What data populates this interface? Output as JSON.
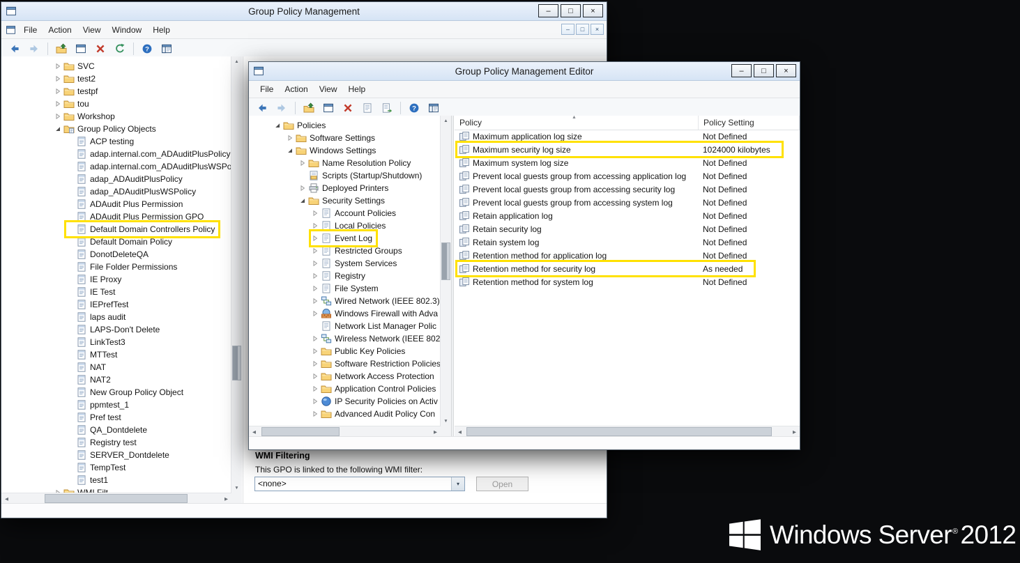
{
  "desktop_bg": "#0A0B0D",
  "highlight_color": "#FFE100",
  "branding": {
    "name": "Windows Server",
    "reg": "®",
    "year": "2012"
  },
  "gpm": {
    "title": "Group Policy Management",
    "menu": [
      "File",
      "Action",
      "View",
      "Window",
      "Help"
    ],
    "title_buttons": [
      "minimize",
      "maximize",
      "close"
    ],
    "mini_buttons": [
      "minimize",
      "restore",
      "close"
    ],
    "toolbar": [
      "back",
      "forward",
      "sep",
      "up-one-level",
      "console-window",
      "delete",
      "refresh",
      "sep",
      "help",
      "console-tree"
    ],
    "tree": [
      {
        "label": "SVC",
        "indent": 1,
        "arrow": "collapsed",
        "icon": "ou-folder"
      },
      {
        "label": "test2",
        "indent": 1,
        "arrow": "collapsed",
        "icon": "ou-folder"
      },
      {
        "label": "testpf",
        "indent": 1,
        "arrow": "collapsed",
        "icon": "ou-folder"
      },
      {
        "label": "tou",
        "indent": 1,
        "arrow": "collapsed",
        "icon": "ou-folder"
      },
      {
        "label": "Workshop",
        "indent": 1,
        "arrow": "collapsed",
        "icon": "folder"
      },
      {
        "label": "Group Policy Objects",
        "indent": 1,
        "arrow": "expanded",
        "icon": "gpo-folder"
      },
      {
        "label": "ACP testing",
        "indent": 2,
        "arrow": "none",
        "icon": "gpo"
      },
      {
        "label": "adap.internal.com_ADAuditPlusPolicy",
        "indent": 2,
        "arrow": "none",
        "icon": "gpo"
      },
      {
        "label": "adap.internal.com_ADAuditPlusWSPo",
        "indent": 2,
        "arrow": "none",
        "icon": "gpo"
      },
      {
        "label": "adap_ADAuditPlusPolicy",
        "indent": 2,
        "arrow": "none",
        "icon": "gpo"
      },
      {
        "label": "adap_ADAuditPlusWSPolicy",
        "indent": 2,
        "arrow": "none",
        "icon": "gpo"
      },
      {
        "label": "ADAudit Plus Permission",
        "indent": 2,
        "arrow": "none",
        "icon": "gpo"
      },
      {
        "label": "ADAudit Plus Permission GPO",
        "indent": 2,
        "arrow": "none",
        "icon": "gpo"
      },
      {
        "label": "Default Domain Controllers Policy",
        "indent": 2,
        "arrow": "none",
        "icon": "gpo",
        "highlight": true
      },
      {
        "label": "Default Domain Policy",
        "indent": 2,
        "arrow": "none",
        "icon": "gpo"
      },
      {
        "label": "DonotDeleteQA",
        "indent": 2,
        "arrow": "none",
        "icon": "gpo"
      },
      {
        "label": "File Folder Permissions",
        "indent": 2,
        "arrow": "none",
        "icon": "gpo"
      },
      {
        "label": "IE Proxy",
        "indent": 2,
        "arrow": "none",
        "icon": "gpo"
      },
      {
        "label": "IE Test",
        "indent": 2,
        "arrow": "none",
        "icon": "gpo"
      },
      {
        "label": "IEPrefTest",
        "indent": 2,
        "arrow": "none",
        "icon": "gpo"
      },
      {
        "label": "laps audit",
        "indent": 2,
        "arrow": "none",
        "icon": "gpo"
      },
      {
        "label": "LAPS-Don't Delete",
        "indent": 2,
        "arrow": "none",
        "icon": "gpo"
      },
      {
        "label": "LinkTest3",
        "indent": 2,
        "arrow": "none",
        "icon": "gpo"
      },
      {
        "label": "MTTest",
        "indent": 2,
        "arrow": "none",
        "icon": "gpo"
      },
      {
        "label": "NAT",
        "indent": 2,
        "arrow": "none",
        "icon": "gpo"
      },
      {
        "label": "NAT2",
        "indent": 2,
        "arrow": "none",
        "icon": "gpo"
      },
      {
        "label": "New Group Policy Object",
        "indent": 2,
        "arrow": "none",
        "icon": "gpo"
      },
      {
        "label": "ppmtest_1",
        "indent": 2,
        "arrow": "none",
        "icon": "gpo"
      },
      {
        "label": "Pref test",
        "indent": 2,
        "arrow": "none",
        "icon": "gpo"
      },
      {
        "label": "QA_Dontdelete",
        "indent": 2,
        "arrow": "none",
        "icon": "gpo"
      },
      {
        "label": "Registry test",
        "indent": 2,
        "arrow": "none",
        "icon": "gpo"
      },
      {
        "label": "SERVER_Dontdelete",
        "indent": 2,
        "arrow": "none",
        "icon": "gpo"
      },
      {
        "label": "TempTest",
        "indent": 2,
        "arrow": "none",
        "icon": "gpo"
      },
      {
        "label": "test1",
        "indent": 2,
        "arrow": "none",
        "icon": "gpo"
      },
      {
        "label": "WMI Filt",
        "indent": 1,
        "arrow": "collapsed",
        "icon": "folder"
      }
    ],
    "wmi": {
      "heading": "WMI Filtering",
      "label": "This GPO is linked to the following WMI filter:",
      "dropdown_value": "<none>",
      "open_button": "Open"
    }
  },
  "editor": {
    "title": "Group Policy Management Editor",
    "menu": [
      "File",
      "Action",
      "View",
      "Help"
    ],
    "title_buttons": [
      "minimize",
      "maximize",
      "close"
    ],
    "toolbar": [
      "back",
      "forward",
      "sep",
      "up-one-level",
      "console-window",
      "delete",
      "properties",
      "export-list",
      "sep",
      "help",
      "console-tree"
    ],
    "tree": [
      {
        "label": "Policies",
        "indent": 1,
        "arrow": "expanded",
        "icon": "folder"
      },
      {
        "label": "Software Settings",
        "indent": 2,
        "arrow": "collapsed",
        "icon": "folder"
      },
      {
        "label": "Windows Settings",
        "indent": 2,
        "arrow": "expanded",
        "icon": "folder"
      },
      {
        "label": "Name Resolution Policy",
        "indent": 3,
        "arrow": "collapsed",
        "icon": "folder"
      },
      {
        "label": "Scripts (Startup/Shutdown)",
        "indent": 3,
        "arrow": "none",
        "icon": "script"
      },
      {
        "label": "Deployed Printers",
        "indent": 3,
        "arrow": "collapsed",
        "icon": "printer"
      },
      {
        "label": "Security Settings",
        "indent": 3,
        "arrow": "expanded",
        "icon": "security-folder"
      },
      {
        "label": "Account Policies",
        "indent": 4,
        "arrow": "collapsed",
        "icon": "policy-doc"
      },
      {
        "label": "Local Policies",
        "indent": 4,
        "arrow": "collapsed",
        "icon": "policy-doc"
      },
      {
        "label": "Event Log",
        "indent": 4,
        "arrow": "collapsed",
        "icon": "policy-doc",
        "highlight": true
      },
      {
        "label": "Restricted Groups",
        "indent": 4,
        "arrow": "collapsed",
        "icon": "policy-doc"
      },
      {
        "label": "System Services",
        "indent": 4,
        "arrow": "collapsed",
        "icon": "policy-doc"
      },
      {
        "label": "Registry",
        "indent": 4,
        "arrow": "collapsed",
        "icon": "policy-doc"
      },
      {
        "label": "File System",
        "indent": 4,
        "arrow": "collapsed",
        "icon": "policy-doc"
      },
      {
        "label": "Wired Network (IEEE 802.3)",
        "indent": 4,
        "arrow": "collapsed",
        "icon": "network"
      },
      {
        "label": "Windows Firewall with Adva",
        "indent": 4,
        "arrow": "collapsed",
        "icon": "firewall"
      },
      {
        "label": "Network List Manager Polic",
        "indent": 4,
        "arrow": "none",
        "icon": "doc"
      },
      {
        "label": "Wireless Network (IEEE 802.",
        "indent": 4,
        "arrow": "collapsed",
        "icon": "network"
      },
      {
        "label": "Public Key Policies",
        "indent": 4,
        "arrow": "collapsed",
        "icon": "folder"
      },
      {
        "label": "Software Restriction Policies",
        "indent": 4,
        "arrow": "collapsed",
        "icon": "folder"
      },
      {
        "label": "Network Access Protection",
        "indent": 4,
        "arrow": "collapsed",
        "icon": "folder"
      },
      {
        "label": "Application Control Policies",
        "indent": 4,
        "arrow": "collapsed",
        "icon": "folder"
      },
      {
        "label": "IP Security Policies on Activ",
        "indent": 4,
        "arrow": "collapsed",
        "icon": "orb"
      },
      {
        "label": "Advanced Audit Policy Con",
        "indent": 4,
        "arrow": "collapsed",
        "icon": "folder"
      }
    ],
    "list": {
      "columns": [
        "Policy",
        "Policy Setting"
      ],
      "sort": "ascending",
      "rows": [
        {
          "policy": "Maximum application log size",
          "setting": "Not Defined"
        },
        {
          "policy": "Maximum security log size",
          "setting": "1024000 kilobytes",
          "highlight": true
        },
        {
          "policy": "Maximum system log size",
          "setting": "Not Defined"
        },
        {
          "policy": "Prevent local guests group from accessing application log",
          "setting": "Not Defined"
        },
        {
          "policy": "Prevent local guests group from accessing security log",
          "setting": "Not Defined"
        },
        {
          "policy": "Prevent local guests group from accessing system log",
          "setting": "Not Defined"
        },
        {
          "policy": "Retain application log",
          "setting": "Not Defined"
        },
        {
          "policy": "Retain security log",
          "setting": "Not Defined"
        },
        {
          "policy": "Retain system log",
          "setting": "Not Defined"
        },
        {
          "policy": "Retention method for application log",
          "setting": "Not Defined"
        },
        {
          "policy": "Retention method for security log",
          "setting": "As needed",
          "highlight": true
        },
        {
          "policy": "Retention method for system log",
          "setting": "Not Defined"
        }
      ]
    }
  }
}
